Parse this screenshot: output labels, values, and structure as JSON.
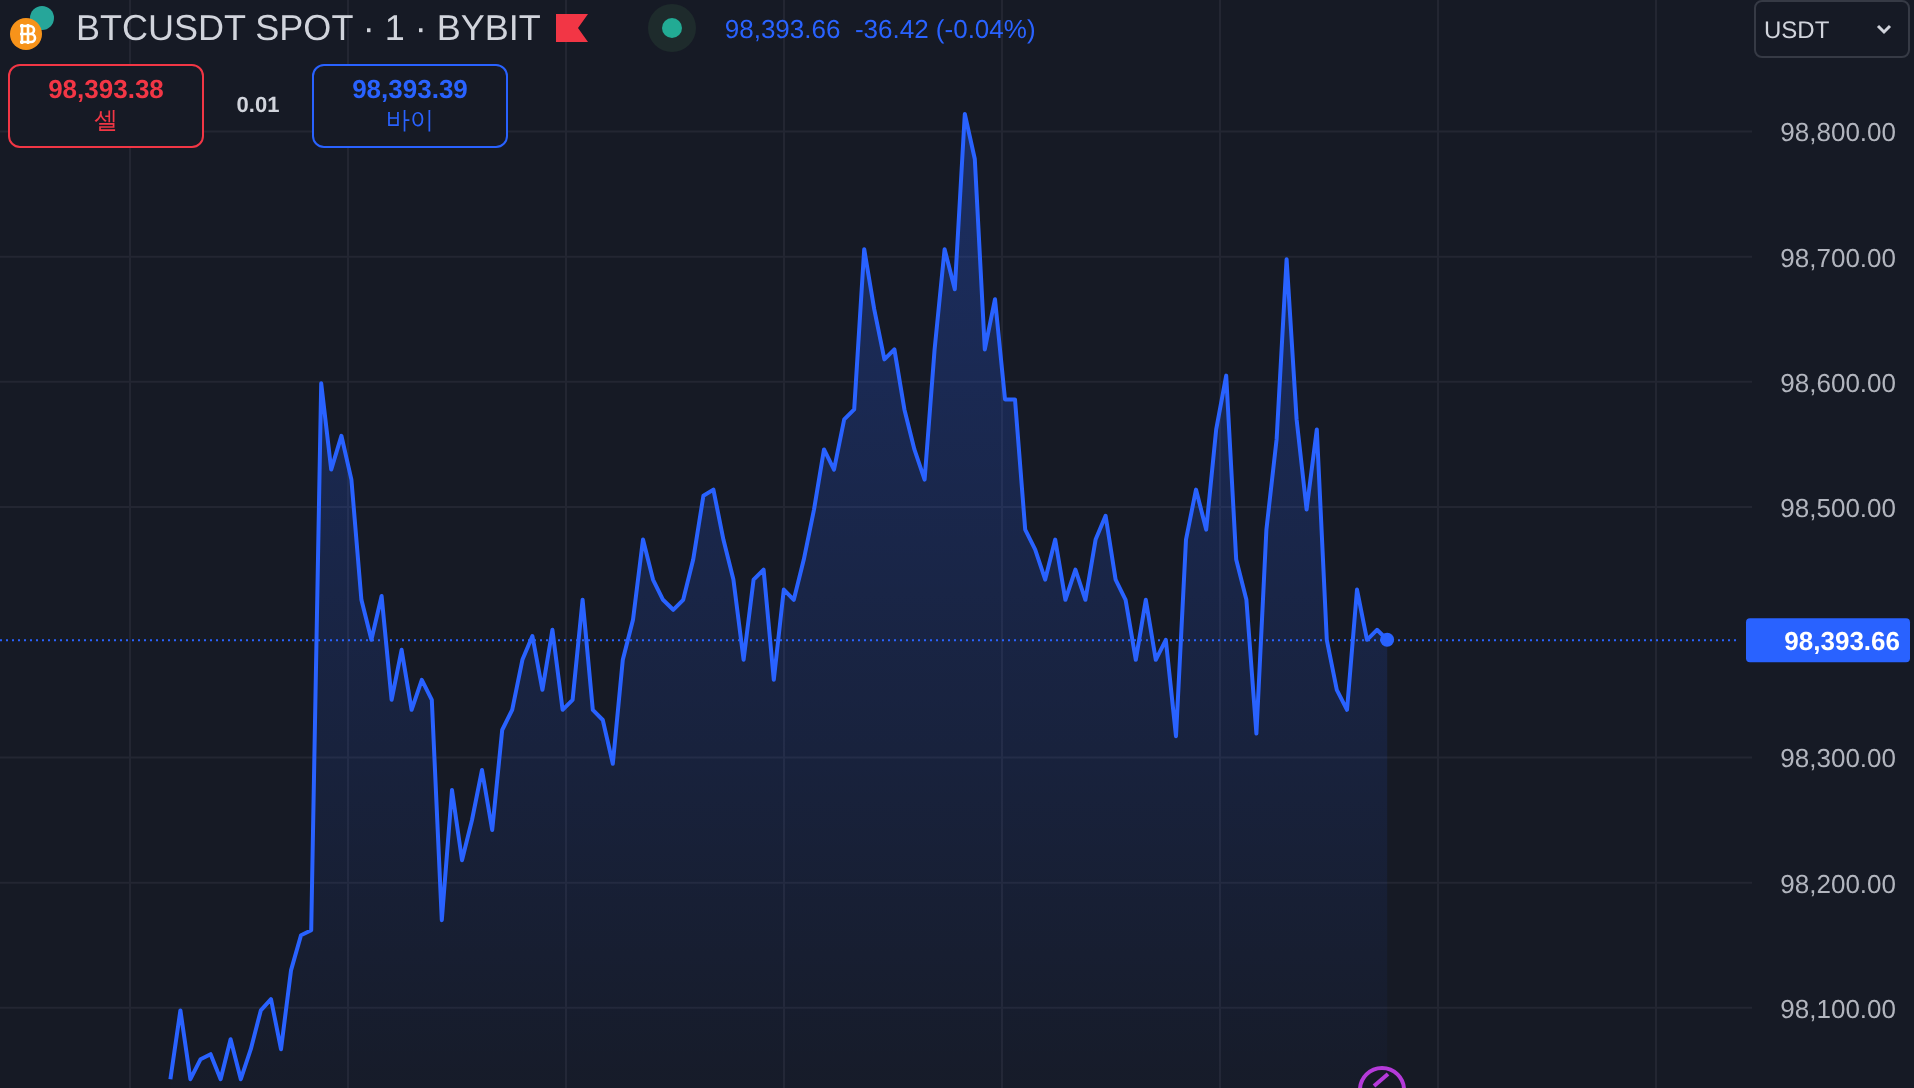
{
  "header": {
    "symbol": "BTCUSDT SPOT · 1 · BYBIT",
    "quote": {
      "price": "98,393.66",
      "change": "-36.42 (-0.04%)"
    }
  },
  "order": {
    "sell": {
      "price": "98,393.38",
      "label": "셀"
    },
    "spread": "0.01",
    "buy": {
      "price": "98,393.39",
      "label": "바이"
    }
  },
  "currency_select": {
    "value": "USDT"
  },
  "chart_data": {
    "type": "area",
    "grid": true,
    "ylim": [
      98036,
      98905
    ],
    "yticks": [
      {
        "value": 98100,
        "label": "98,100.00"
      },
      {
        "value": 98200,
        "label": "98,200.00"
      },
      {
        "value": 98300,
        "label": "98,300.00"
      },
      {
        "value": 98500,
        "label": "98,500.00"
      },
      {
        "value": 98600,
        "label": "98,600.00"
      },
      {
        "value": 98700,
        "label": "98,700.00"
      },
      {
        "value": 98800,
        "label": "98,800.00"
      }
    ],
    "series": [
      {
        "color": "#2962ff",
        "values": [
          98043,
          98098,
          98043,
          98059,
          98063,
          98043,
          98075,
          98043,
          98067,
          98098,
          98107,
          98067,
          98130,
          98158,
          98162,
          98599,
          98530,
          98557,
          98522,
          98426,
          98394,
          98429,
          98346,
          98386,
          98338,
          98362,
          98346,
          98170,
          98274,
          98218,
          98250,
          98290,
          98242,
          98322,
          98338,
          98378,
          98397,
          98354,
          98402,
          98338,
          98346,
          98426,
          98338,
          98330,
          98295,
          98378,
          98410,
          98474,
          98442,
          98426,
          98418,
          98426,
          98458,
          98509,
          98514,
          98474,
          98442,
          98378,
          98442,
          98450,
          98362,
          98434,
          98426,
          98458,
          98498,
          98546,
          98530,
          98570,
          98578,
          98706,
          98658,
          98618,
          98626,
          98578,
          98546,
          98522,
          98626,
          98706,
          98674,
          98814,
          98778,
          98626,
          98666,
          98586,
          98586,
          98482,
          98466,
          98442,
          98474,
          98426,
          98450,
          98426,
          98474,
          98493,
          98442,
          98426,
          98378,
          98426,
          98378,
          98394,
          98317,
          98474,
          98514,
          98482,
          98562,
          98605,
          98458,
          98426,
          98319,
          98482,
          98554,
          98698,
          98570,
          98498,
          98562,
          98394,
          98354,
          98338,
          98434,
          98394,
          98402,
          98394
        ]
      }
    ],
    "ref_lines": [
      {
        "axis": "y",
        "value": 98393.66,
        "label": "98,393.66"
      }
    ]
  }
}
